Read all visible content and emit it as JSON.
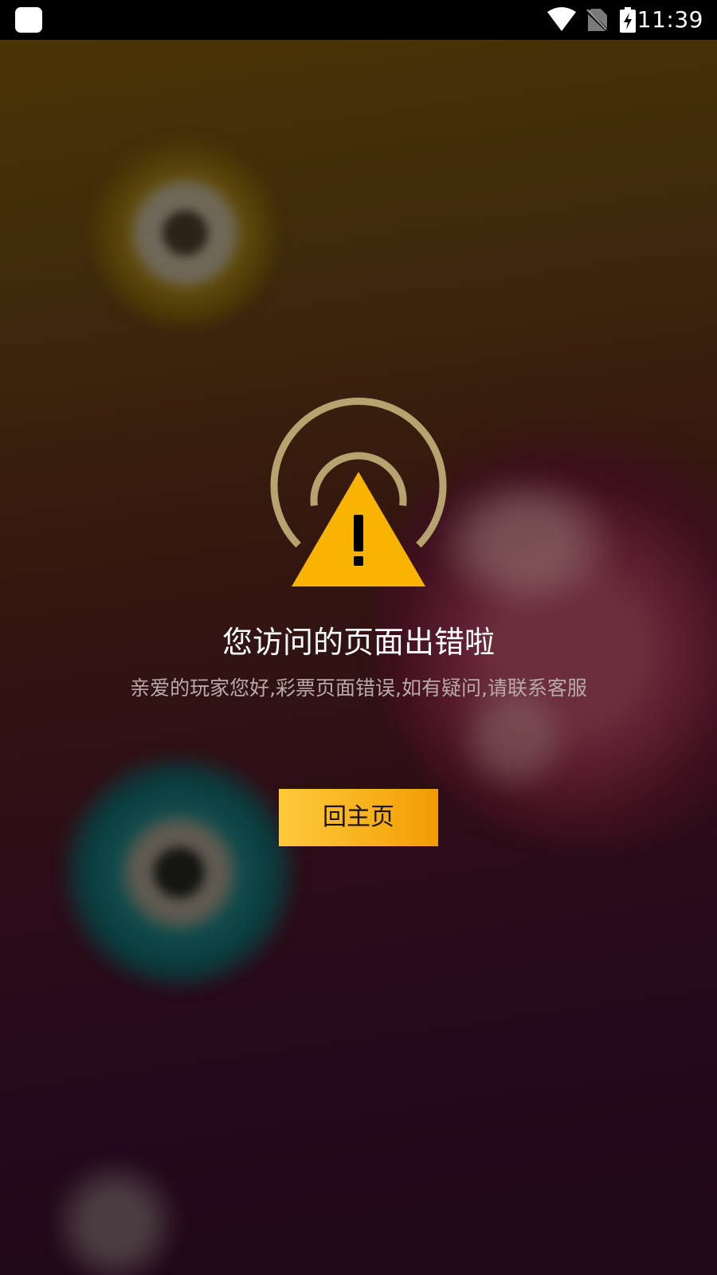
{
  "status_bar": {
    "time": "11:39",
    "icons": [
      "app-notification-icon",
      "wifi-icon",
      "no-sim-icon",
      "battery-charging-icon"
    ]
  },
  "error_page": {
    "icon": "signal-warning-icon",
    "title": "您访问的页面出错啦",
    "message": "亲爱的玩家您好,彩票页面错误,如有疑问,请联系客服",
    "home_button_label": "回主页"
  },
  "colors": {
    "accent": "#f9b21d",
    "signal_rings": "#b7a36f",
    "warning_triangle": "#f8b400",
    "title_text": "#ffffff",
    "message_text": "#b9aaa8"
  }
}
